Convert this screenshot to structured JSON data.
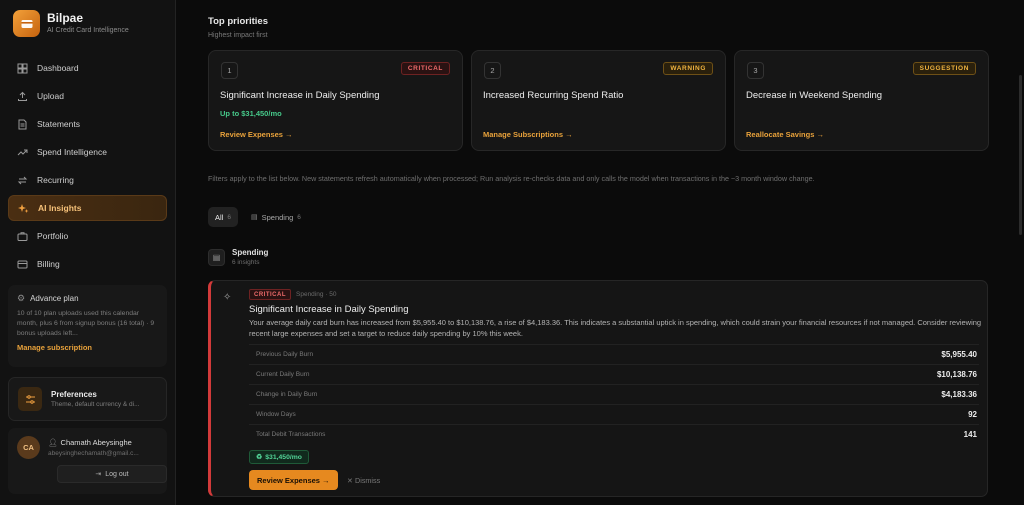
{
  "brand": {
    "name": "Bilpae",
    "tagline": "AI Credit Card Intelligence"
  },
  "nav": [
    {
      "label": "Dashboard",
      "icon": "grid-icon"
    },
    {
      "label": "Upload",
      "icon": "upload-icon"
    },
    {
      "label": "Statements",
      "icon": "document-icon"
    },
    {
      "label": "Spend Intelligence",
      "icon": "trend-icon"
    },
    {
      "label": "Recurring",
      "icon": "repeat-icon"
    },
    {
      "label": "AI Insights",
      "icon": "sparkle-icon",
      "active": true
    },
    {
      "label": "Portfolio",
      "icon": "briefcase-icon"
    },
    {
      "label": "Billing",
      "icon": "card-icon"
    }
  ],
  "plan": {
    "title": "Advance plan",
    "desc": "10 of 10 plan uploads used this calendar month, plus 6 from signup bonus (16 total) · 9 bonus uploads left...",
    "link": "Manage subscription"
  },
  "prefs": {
    "title": "Preferences",
    "sub": "Theme, default currency & di..."
  },
  "user": {
    "initials": "CA",
    "name": "Chamath Abeysinghe",
    "email": "abeysinghechamath@gmail.c...",
    "logout": "Log out"
  },
  "priorities": {
    "title": "Top priorities",
    "subtitle": "Highest impact first",
    "cards": [
      {
        "num": "1",
        "badge": "CRITICAL",
        "title": "Significant Increase in Daily Spending",
        "amount": "Up to $31,450/mo",
        "link": "Review Expenses →"
      },
      {
        "num": "2",
        "badge": "WARNING",
        "title": "Increased Recurring Spend Ratio",
        "amount": "",
        "link": "Manage Subscriptions →"
      },
      {
        "num": "3",
        "badge": "SUGGESTION",
        "title": "Decrease in Weekend Spending",
        "amount": "",
        "link": "Reallocate Savings →"
      }
    ]
  },
  "filter_note": "Filters apply to the list below. New statements refresh automatically when processed; Run analysis re-checks data and only calls the model when transactions in the ~3 month window change.",
  "tabs": [
    {
      "label": "All",
      "count": "6"
    },
    {
      "label": "Spending",
      "count": "6"
    }
  ],
  "group": {
    "title": "Spending",
    "sub": "6 insights"
  },
  "insight": {
    "badge": "CRITICAL",
    "meta": "Spending · 50",
    "title": "Significant Increase in Daily Spending",
    "desc": "Your average daily card burn has increased from $5,955.40 to $10,138.76, a rise of $4,183.36. This indicates a substantial uptick in spending, which could strain your financial resources if not managed. Consider reviewing recent large expenses and set a target to reduce daily spending by 10% this week.",
    "metrics": [
      {
        "label": "Previous Daily Burn",
        "value": "$5,955.40"
      },
      {
        "label": "Current Daily Burn",
        "value": "$10,138.76"
      },
      {
        "label": "Change in Daily Burn",
        "value": "$4,183.36"
      },
      {
        "label": "Window Days",
        "value": "92"
      },
      {
        "label": "Total Debit Transactions",
        "value": "141"
      }
    ],
    "amount": "$31,450/mo",
    "cta": "Review Expenses →",
    "dismiss": "Dismiss"
  }
}
